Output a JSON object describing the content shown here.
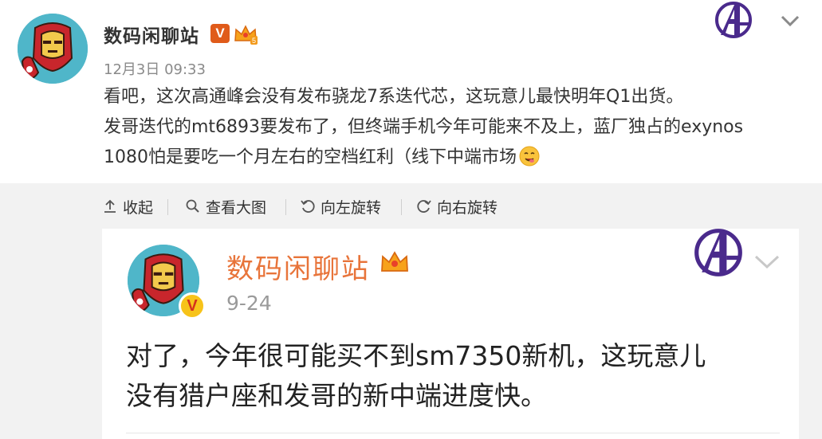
{
  "post": {
    "author": "数码闲聊站",
    "verified_badge": "V",
    "timestamp": "12月3日 09:33",
    "lines": [
      "看吧，这次高通峰会没有发布骁龙7系迭代芯，这玩意儿最快明年Q1出货。",
      "发哥迭代的mt6893要发布了，但终端手机今年可能来不及上，蓝厂独占的exynos",
      "1080怕是要吃一个月左右的空档红利（线下中端市场"
    ],
    "avatar_icon": "iron-man-avatar",
    "member_icon": "crown-icon",
    "emoji_icon": "yummy-emoji-icon"
  },
  "toolbar": {
    "collapse_label": "收起",
    "view_image_label": "查看大图",
    "rotate_left_label": "向左旋转",
    "rotate_right_label": "向右旋转"
  },
  "card": {
    "author": "数码闲聊站",
    "verified_badge": "V",
    "timestamp": "9-24",
    "lines": [
      "对了，今年很可能买不到sm7350新机，这玩意儿",
      "没有猎户座和发哥的新中端进度快。"
    ]
  },
  "colors": {
    "accent_orange": "#e8743a",
    "badge_orange": "#e05b1a",
    "panel_gray": "#f2f2f2",
    "avengers_purple": "#4a2a8c"
  }
}
